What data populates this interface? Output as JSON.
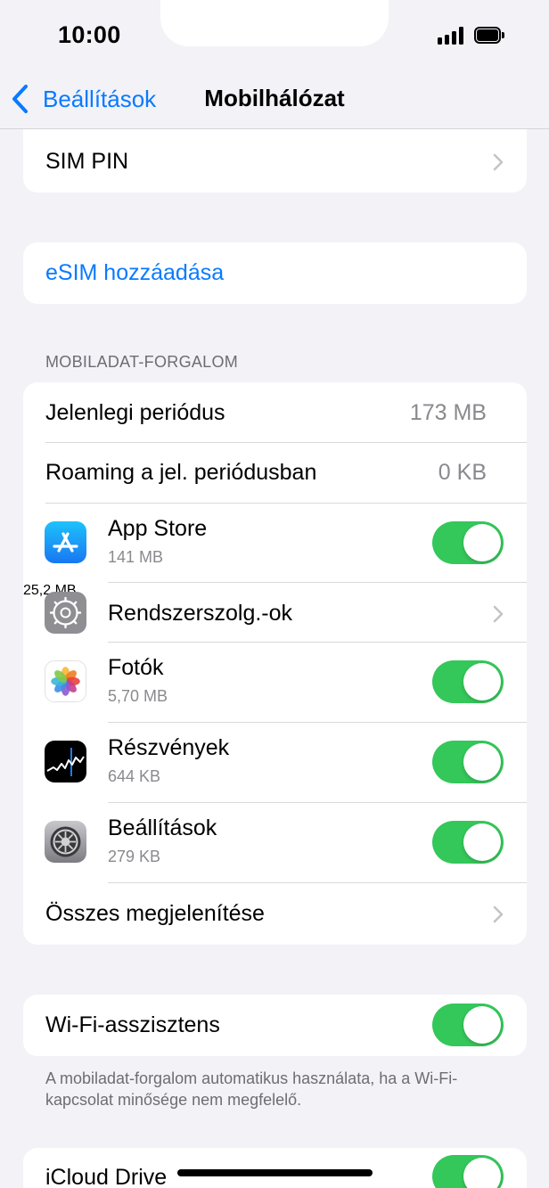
{
  "status_bar": {
    "time": "10:00"
  },
  "nav": {
    "back_label": "Beállítások",
    "title": "Mobilhálózat"
  },
  "sim_pin": {
    "label": "SIM PIN"
  },
  "esim": {
    "label": "eSIM hozzáadása"
  },
  "mobile_data": {
    "header": "MOBILADAT-FORGALOM",
    "current_period": {
      "label": "Jelenlegi periódus",
      "value": "173 MB"
    },
    "roaming_period": {
      "label": "Roaming a jel. periódusban",
      "value": "0 KB"
    },
    "apps": [
      {
        "name": "App Store",
        "usage": "141 MB",
        "enabled": true,
        "icon": "app-store-icon"
      },
      {
        "name": "Rendszerszolg.-ok",
        "usage": "25,2 MB",
        "icon": "system-services-icon"
      },
      {
        "name": "Fotók",
        "usage": "5,70 MB",
        "enabled": true,
        "icon": "photos-icon"
      },
      {
        "name": "Részvények",
        "usage": "644 KB",
        "enabled": true,
        "icon": "stocks-icon"
      },
      {
        "name": "Beállítások",
        "usage": "279 KB",
        "enabled": true,
        "icon": "settings-icon"
      }
    ],
    "show_all": "Összes megjelenítése"
  },
  "wifi_assist": {
    "label": "Wi-Fi-asszisztens",
    "enabled": true,
    "footnote": "A mobiladat-forgalom automatikus használata, ha a Wi-Fi-kapcsolat minősége nem megfelelő."
  },
  "icloud_drive": {
    "label": "iCloud Drive",
    "enabled": true
  },
  "colors": {
    "accent": "#0a7aff",
    "toggle_on": "#34c759",
    "background": "#f2f2f7"
  }
}
